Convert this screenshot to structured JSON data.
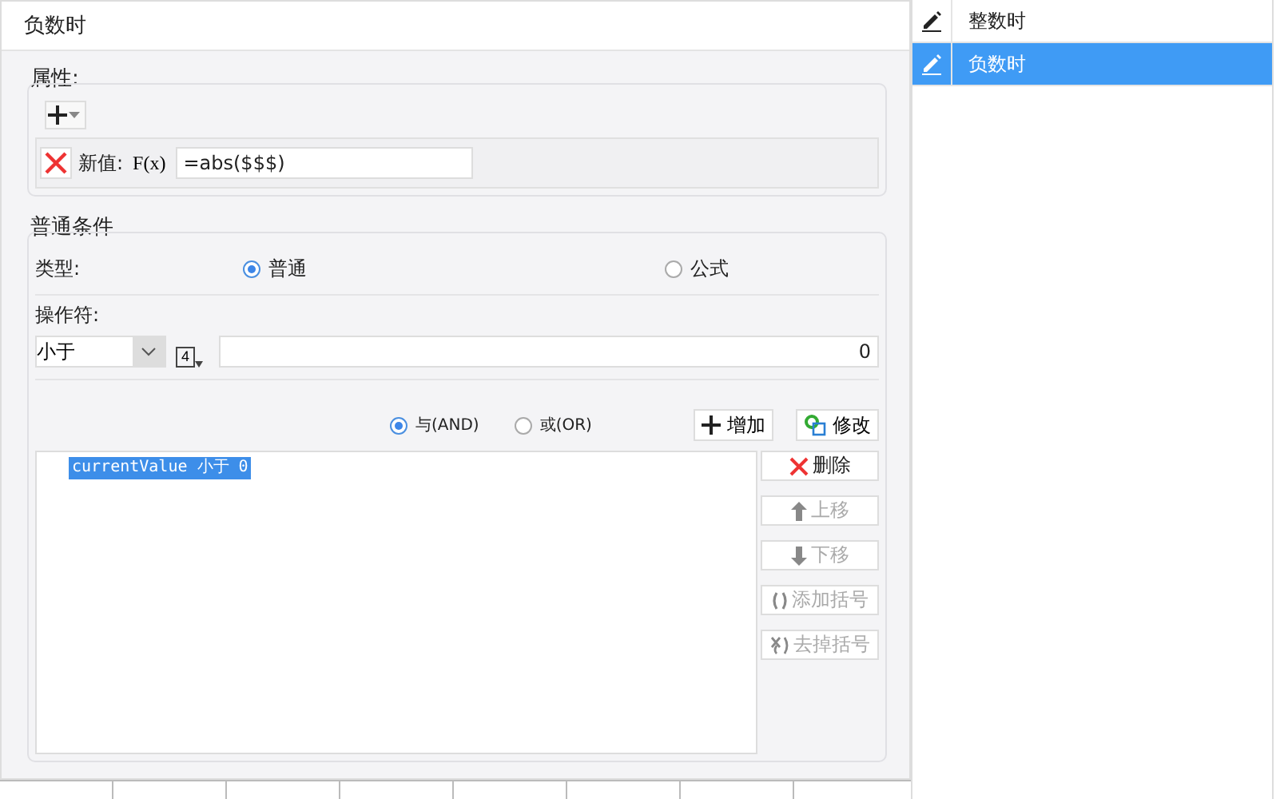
{
  "dialog": {
    "title": "负数时"
  },
  "properties": {
    "legend": "属性:",
    "rows": [
      {
        "label": "新值:",
        "formula_icon": "F(x)",
        "value": "=abs($$$)"
      }
    ]
  },
  "condition": {
    "legend": "普通条件",
    "type_label": "类型:",
    "types": [
      {
        "label": "普通",
        "selected": true
      },
      {
        "label": "公式",
        "selected": false
      }
    ],
    "operator_label": "操作符:",
    "operator": "小于",
    "value_type": "4",
    "value": "0",
    "joins": [
      {
        "label": "与(AND)",
        "selected": true
      },
      {
        "label": "或(OR)",
        "selected": false
      }
    ],
    "actions": [
      {
        "label": "增加",
        "kind": "add"
      },
      {
        "label": "修改",
        "kind": "edit"
      }
    ],
    "expressions": [
      {
        "text": "currentValue 小于 0",
        "selected": true
      }
    ],
    "side_buttons": [
      {
        "label": "删除",
        "kind": "delete",
        "disabled": false
      },
      {
        "label": "上移",
        "kind": "up",
        "disabled": true
      },
      {
        "label": "下移",
        "kind": "down",
        "disabled": true
      },
      {
        "label": "添加括号",
        "kind": "paren",
        "disabled": true
      },
      {
        "label": "去掉括号",
        "kind": "unparen",
        "disabled": true
      }
    ]
  },
  "list": {
    "items": [
      {
        "label": "整数时",
        "selected": false
      },
      {
        "label": "负数时",
        "selected": true
      }
    ]
  }
}
